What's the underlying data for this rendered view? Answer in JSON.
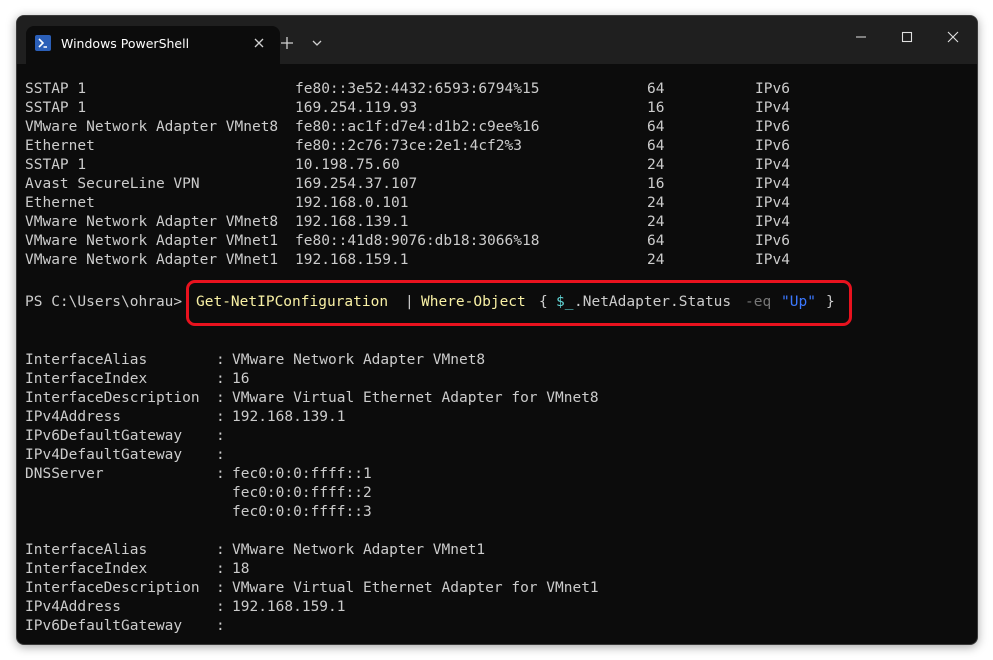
{
  "window": {
    "title": "Windows PowerShell"
  },
  "colors": {
    "background": "#0c0c0c",
    "titlebar": "#1f1f1f",
    "text": "#cccccc",
    "cmdlet": "#f9f1a5",
    "variable": "#61d6d6",
    "operator": "#767676",
    "string": "#3b78ff",
    "highlight": "#e8121e"
  },
  "table_rows": [
    {
      "alias": "SSTAP 1",
      "address": "fe80::3e52:4432:6593:6794%15",
      "prefix": "64",
      "family": "IPv6"
    },
    {
      "alias": "SSTAP 1",
      "address": "169.254.119.93",
      "prefix": "16",
      "family": "IPv4"
    },
    {
      "alias": "VMware Network Adapter VMnet8",
      "address": "fe80::ac1f:d7e4:d1b2:c9ee%16",
      "prefix": "64",
      "family": "IPv6"
    },
    {
      "alias": "Ethernet",
      "address": "fe80::2c76:73ce:2e1:4cf2%3",
      "prefix": "64",
      "family": "IPv6"
    },
    {
      "alias": "SSTAP 1",
      "address": "10.198.75.60",
      "prefix": "24",
      "family": "IPv4"
    },
    {
      "alias": "Avast SecureLine VPN",
      "address": "169.254.37.107",
      "prefix": "16",
      "family": "IPv4"
    },
    {
      "alias": "Ethernet",
      "address": "192.168.0.101",
      "prefix": "24",
      "family": "IPv4"
    },
    {
      "alias": "VMware Network Adapter VMnet8",
      "address": "192.168.139.1",
      "prefix": "24",
      "family": "IPv4"
    },
    {
      "alias": "VMware Network Adapter VMnet1",
      "address": "fe80::41d8:9076:db18:3066%18",
      "prefix": "64",
      "family": "IPv6"
    },
    {
      "alias": "VMware Network Adapter VMnet1",
      "address": "192.168.159.1",
      "prefix": "24",
      "family": "IPv4"
    }
  ],
  "prompt": {
    "text": "PS C:\\Users\\ohrau>",
    "cmdlet1": "Get-NetIPConfiguration",
    "pipe": "|",
    "cmdlet2": "Where-Object",
    "brace_open": "{",
    "variable": "$_",
    "property": ".NetAdapter.Status",
    "operator": "-eq",
    "string": "\"Up\"",
    "brace_close": "}"
  },
  "config_blocks": [
    {
      "lines": [
        {
          "key": "InterfaceAlias",
          "sep": ":",
          "value": "VMware Network Adapter VMnet8"
        },
        {
          "key": "InterfaceIndex",
          "sep": ":",
          "value": "16"
        },
        {
          "key": "InterfaceDescription",
          "sep": ":",
          "value": "VMware Virtual Ethernet Adapter for VMnet8"
        },
        {
          "key": "IPv4Address",
          "sep": ":",
          "value": "192.168.139.1"
        },
        {
          "key": "IPv6DefaultGateway",
          "sep": ":",
          "value": ""
        },
        {
          "key": "IPv4DefaultGateway",
          "sep": ":",
          "value": ""
        },
        {
          "key": "DNSServer",
          "sep": ":",
          "value": "fec0:0:0:ffff::1"
        },
        {
          "key": "",
          "sep": "",
          "value": "fec0:0:0:ffff::2"
        },
        {
          "key": "",
          "sep": "",
          "value": "fec0:0:0:ffff::3"
        }
      ]
    },
    {
      "lines": [
        {
          "key": "InterfaceAlias",
          "sep": ":",
          "value": "VMware Network Adapter VMnet1"
        },
        {
          "key": "InterfaceIndex",
          "sep": ":",
          "value": "18"
        },
        {
          "key": "InterfaceDescription",
          "sep": ":",
          "value": "VMware Virtual Ethernet Adapter for VMnet1"
        },
        {
          "key": "IPv4Address",
          "sep": ":",
          "value": "192.168.159.1"
        },
        {
          "key": "IPv6DefaultGateway",
          "sep": ":",
          "value": ""
        }
      ]
    }
  ]
}
